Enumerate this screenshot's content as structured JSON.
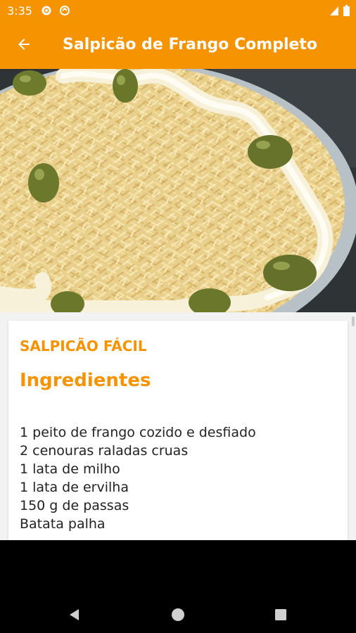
{
  "status_bar": {
    "time": "3:35",
    "icons": [
      "gear-icon",
      "sync-icon",
      "signal-icon",
      "battery-icon"
    ]
  },
  "app_bar": {
    "title": "Salpicão de Frango Completo",
    "back_icon": "arrow-left-icon"
  },
  "hero_image": {
    "description_icon": "salpicao-photo"
  },
  "recipe": {
    "title": "SALPICÃO FÁCIL",
    "section_heading": "Ingredientes",
    "ingredients": [
      "1 peito de frango cozido e desfiado",
      "2 cenouras raladas cruas",
      "1 lata de milho",
      "1 lata de ervilha",
      "150 g de passas",
      "Batata palha"
    ]
  },
  "nav_bar": {
    "icons": [
      "back-triangle-icon",
      "home-circle-icon",
      "recents-square-icon"
    ]
  },
  "colors": {
    "accent": "#f59300",
    "background": "#f2f2f2",
    "card": "#ffffff",
    "text": "#222222"
  }
}
